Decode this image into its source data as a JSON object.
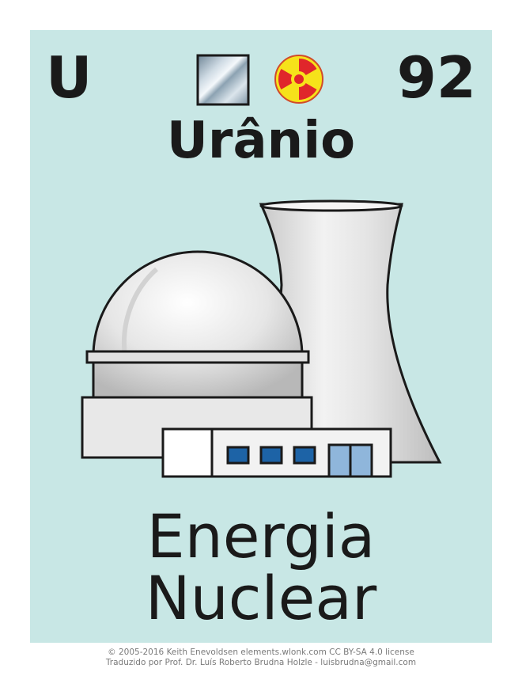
{
  "element": {
    "symbol": "U",
    "atomic_number": "92",
    "name": "Urânio",
    "state_icon": "solid-state-icon",
    "hazard_icon": "radiation-icon"
  },
  "caption": {
    "line1": "Energia",
    "line2": "Nuclear"
  },
  "credits": {
    "line1": "© 2005-2016 Keith Enevoldsen   elements.wlonk.com   CC BY-SA 4.0 license",
    "line2": "Traduzido por Prof. Dr. Luís Roberto Brudna Holzle - luisbrudna@gmail.com"
  },
  "colors": {
    "background": "#c8e7e5",
    "text": "#1a1a1a",
    "radiation_yellow": "#f6e21a",
    "radiation_red": "#e0262b",
    "window_blue": "#1d63a6",
    "door_blue": "#8fb6db"
  }
}
